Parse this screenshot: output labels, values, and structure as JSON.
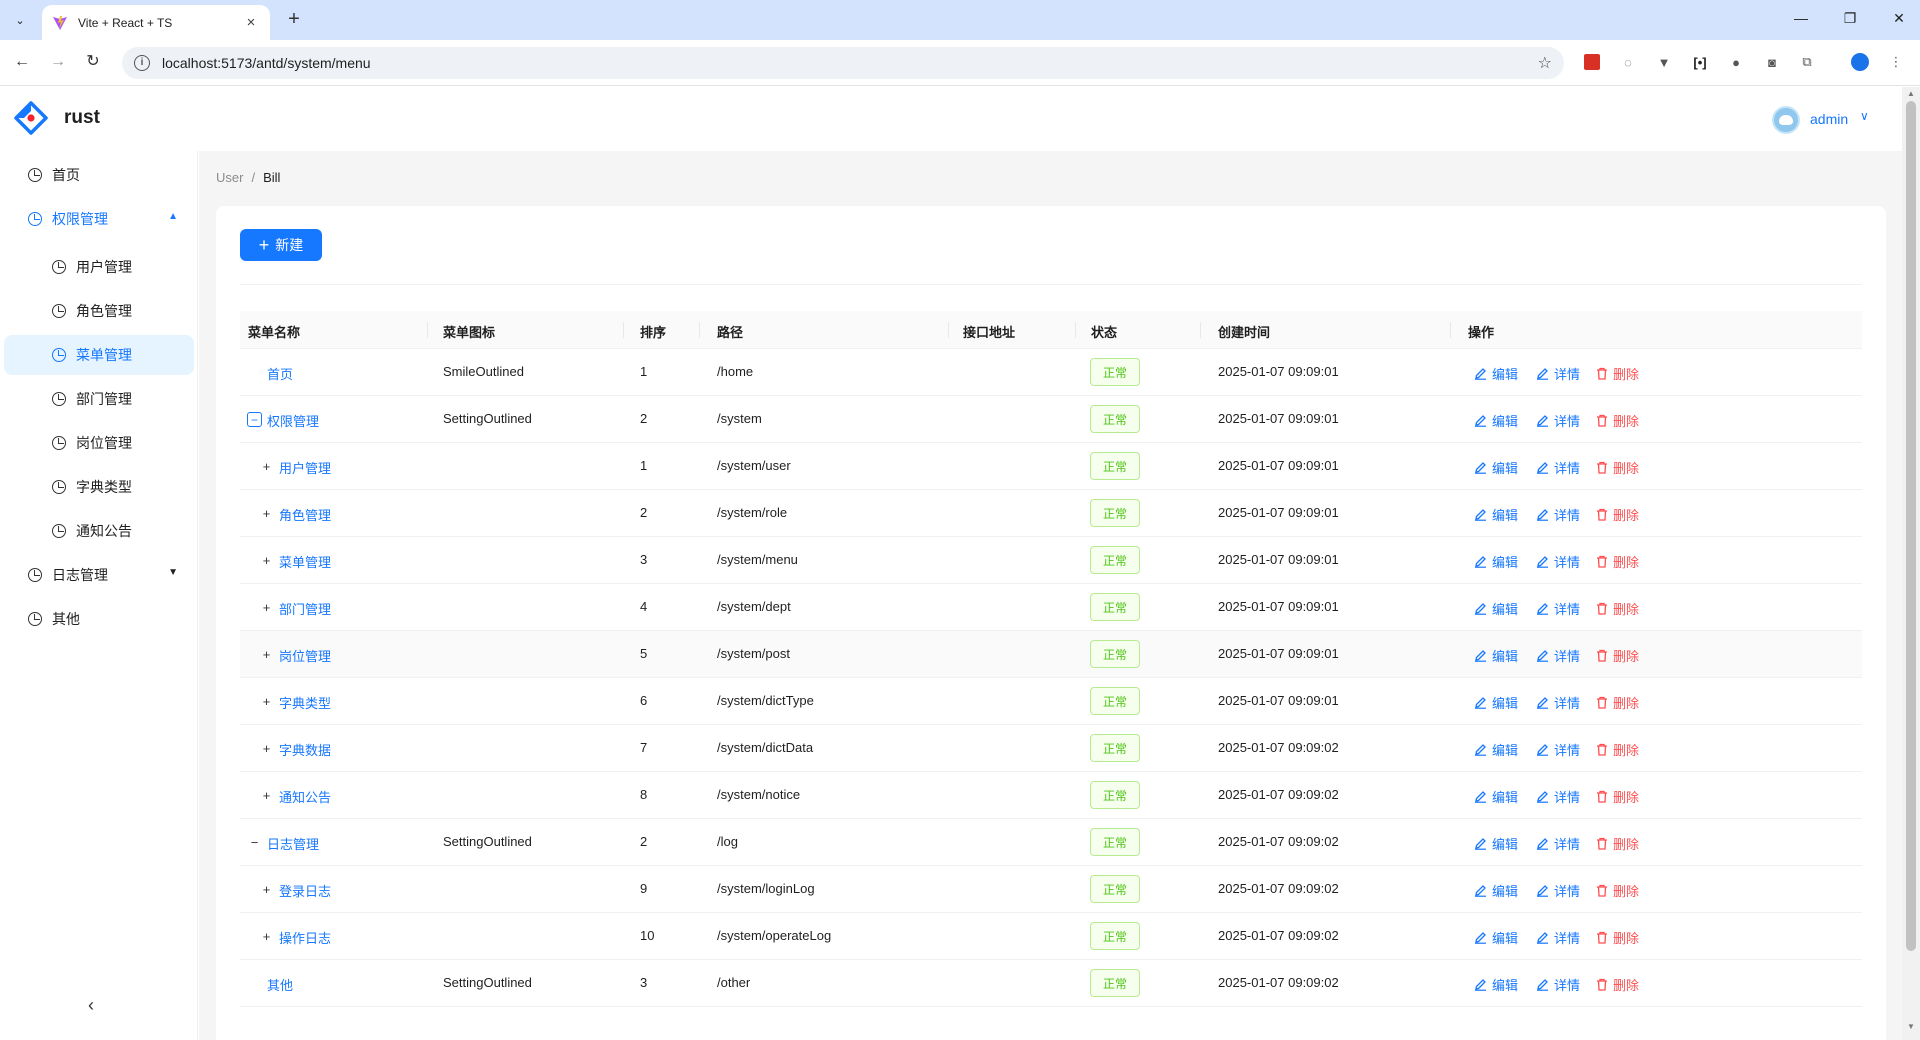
{
  "browser": {
    "tab_title": "Vite + React + TS",
    "url": "localhost:5173/antd/system/menu"
  },
  "header": {
    "app_name": "rust",
    "user_name": "admin"
  },
  "sidebar": {
    "items": [
      {
        "label": "首页"
      },
      {
        "label": "权限管理"
      },
      {
        "label": "用户管理"
      },
      {
        "label": "角色管理"
      },
      {
        "label": "菜单管理"
      },
      {
        "label": "部门管理"
      },
      {
        "label": "岗位管理"
      },
      {
        "label": "字典类型"
      },
      {
        "label": "通知公告"
      },
      {
        "label": "日志管理"
      },
      {
        "label": "其他"
      }
    ]
  },
  "breadcrumb": {
    "items": [
      "User",
      "Bill"
    ]
  },
  "toolbar": {
    "new_label": "新建"
  },
  "table": {
    "columns": [
      "菜单名称",
      "菜单图标",
      "排序",
      "路径",
      "接口地址",
      "状态",
      "创建时间",
      "操作"
    ],
    "actions": {
      "edit": "编辑",
      "detail": "详情",
      "delete": "删除"
    },
    "rows": [
      {
        "name": "首页",
        "icon": "SmileOutlined",
        "sort": "1",
        "path": "/home",
        "api": "",
        "status": "正常",
        "created": "2025-01-07 09:09:01"
      },
      {
        "name": "权限管理",
        "icon": "SettingOutlined",
        "sort": "2",
        "path": "/system",
        "api": "",
        "status": "正常",
        "created": "2025-01-07 09:09:01"
      },
      {
        "name": "用户管理",
        "icon": "",
        "sort": "1",
        "path": "/system/user",
        "api": "",
        "status": "正常",
        "created": "2025-01-07 09:09:01"
      },
      {
        "name": "角色管理",
        "icon": "",
        "sort": "2",
        "path": "/system/role",
        "api": "",
        "status": "正常",
        "created": "2025-01-07 09:09:01"
      },
      {
        "name": "菜单管理",
        "icon": "",
        "sort": "3",
        "path": "/system/menu",
        "api": "",
        "status": "正常",
        "created": "2025-01-07 09:09:01"
      },
      {
        "name": "部门管理",
        "icon": "",
        "sort": "4",
        "path": "/system/dept",
        "api": "",
        "status": "正常",
        "created": "2025-01-07 09:09:01"
      },
      {
        "name": "岗位管理",
        "icon": "",
        "sort": "5",
        "path": "/system/post",
        "api": "",
        "status": "正常",
        "created": "2025-01-07 09:09:01"
      },
      {
        "name": "字典类型",
        "icon": "",
        "sort": "6",
        "path": "/system/dictType",
        "api": "",
        "status": "正常",
        "created": "2025-01-07 09:09:01"
      },
      {
        "name": "字典数据",
        "icon": "",
        "sort": "7",
        "path": "/system/dictData",
        "api": "",
        "status": "正常",
        "created": "2025-01-07 09:09:02"
      },
      {
        "name": "通知公告",
        "icon": "",
        "sort": "8",
        "path": "/system/notice",
        "api": "",
        "status": "正常",
        "created": "2025-01-07 09:09:02"
      },
      {
        "name": "日志管理",
        "icon": "SettingOutlined",
        "sort": "2",
        "path": "/log",
        "api": "",
        "status": "正常",
        "created": "2025-01-07 09:09:02"
      },
      {
        "name": "登录日志",
        "icon": "",
        "sort": "9",
        "path": "/system/loginLog",
        "api": "",
        "status": "正常",
        "created": "2025-01-07 09:09:02"
      },
      {
        "name": "操作日志",
        "icon": "",
        "sort": "10",
        "path": "/system/operateLog",
        "api": "",
        "status": "正常",
        "created": "2025-01-07 09:09:02"
      },
      {
        "name": "其他",
        "icon": "SettingOutlined",
        "sort": "3",
        "path": "/other",
        "api": "",
        "status": "正常",
        "created": "2025-01-07 09:09:02"
      }
    ]
  },
  "colors": {
    "primary": "#1677ff",
    "danger": "#ff4d4f",
    "success": "#52c41a",
    "tab_strip": "#d3e3fd"
  }
}
